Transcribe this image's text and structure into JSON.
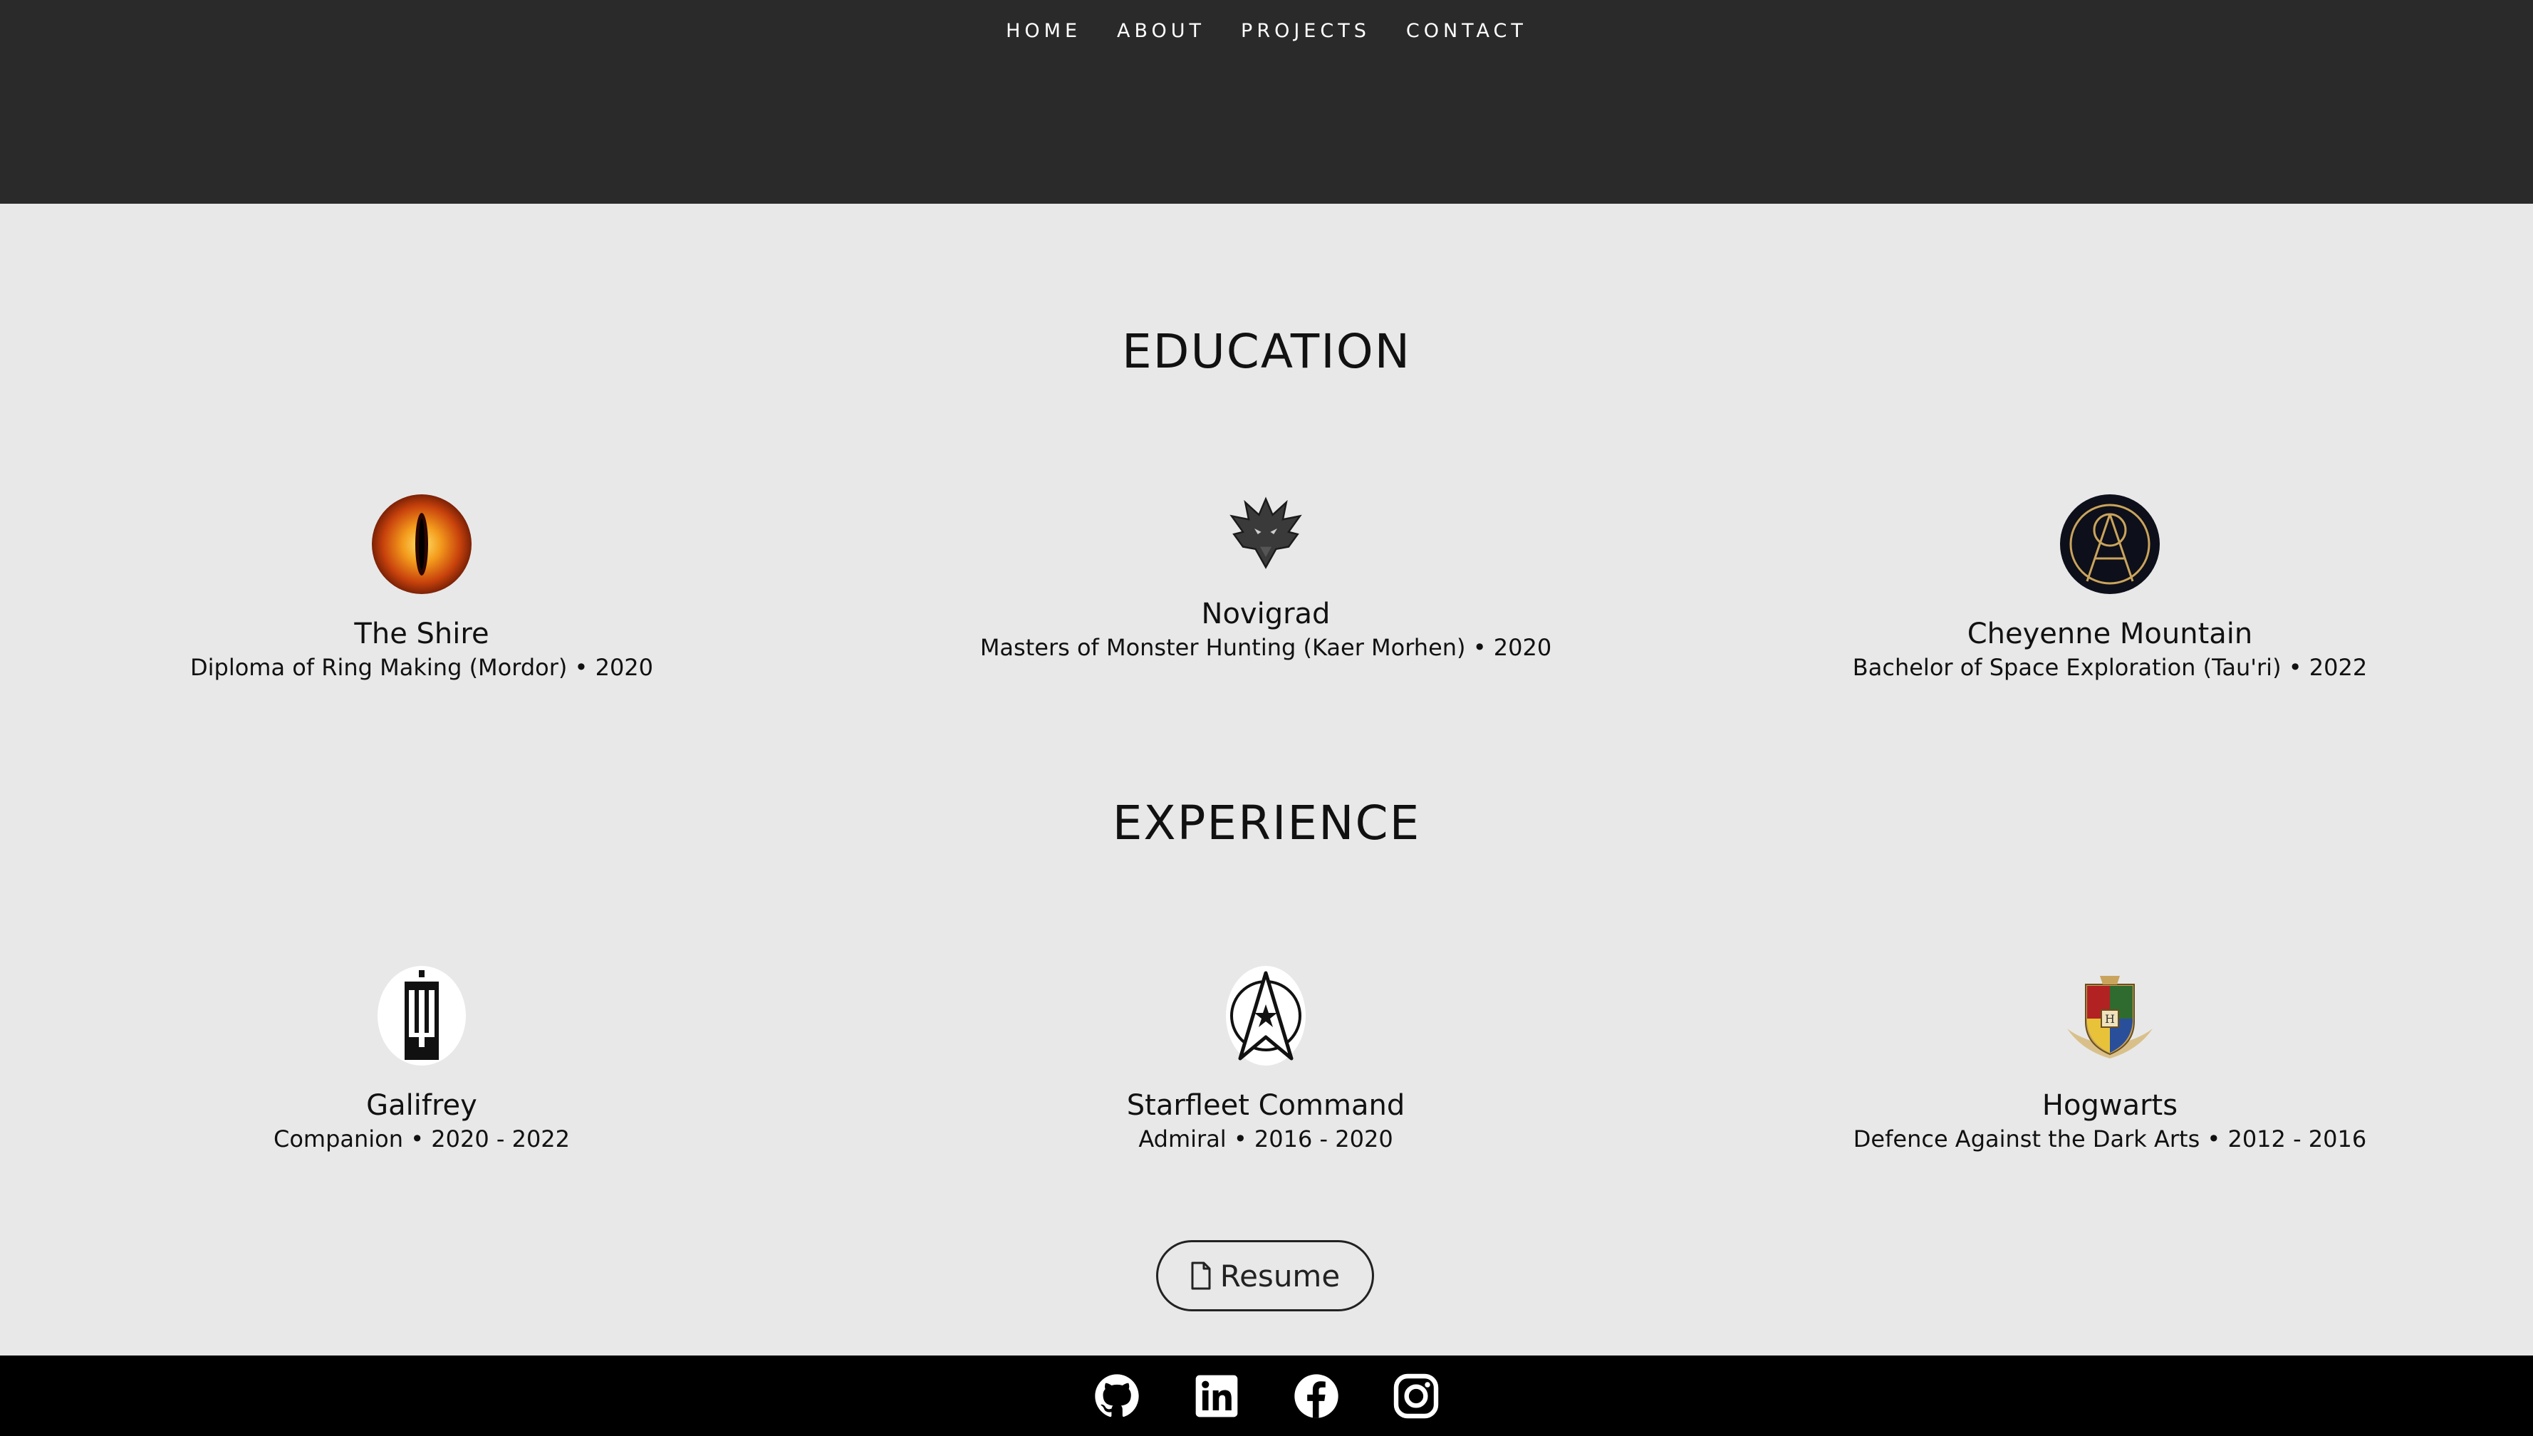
{
  "nav": {
    "items": [
      "HOME",
      "ABOUT",
      "PROJECTS",
      "CONTACT"
    ]
  },
  "education": {
    "title": "EDUCATION",
    "items": [
      {
        "name": "The Shire",
        "detail": "Diploma of Ring Making (Mordor) • 2020",
        "icon": "eye-of-sauron-icon"
      },
      {
        "name": "Novigrad",
        "detail": "Masters of Monster Hunting (Kaer Morhen) • 2020",
        "icon": "wolf-medallion-icon"
      },
      {
        "name": "Cheyenne Mountain",
        "detail": "Bachelor of Space Exploration (Tau'ri) • 2022",
        "icon": "stargate-icon"
      }
    ]
  },
  "experience": {
    "title": "EXPERIENCE",
    "items": [
      {
        "name": "Galifrey",
        "detail": "Companion • 2020 - 2022",
        "icon": "tardis-logo-icon"
      },
      {
        "name": "Starfleet Command",
        "detail": "Admiral • 2016 - 2020",
        "icon": "starfleet-delta-icon"
      },
      {
        "name": "Hogwarts",
        "detail": "Defence Against the Dark Arts • 2012 - 2016",
        "icon": "hogwarts-crest-icon"
      }
    ]
  },
  "resume": {
    "label": "Resume"
  },
  "footer": {
    "icons": [
      "github-icon",
      "linkedin-icon",
      "facebook-icon",
      "instagram-icon"
    ]
  },
  "colors": {
    "header_bg": "#2a2a2a",
    "page_bg": "#e8e8e8",
    "footer_bg": "#000000",
    "text": "#111111"
  }
}
